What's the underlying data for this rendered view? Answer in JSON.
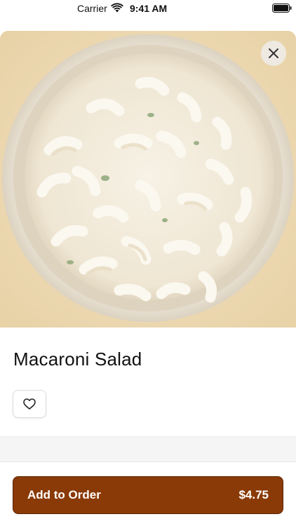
{
  "status_bar": {
    "carrier": "Carrier",
    "time": "9:41 AM",
    "wifi_icon": "wifi-icon",
    "battery_icon": "battery-icon"
  },
  "product": {
    "name": "Macaroni Salad",
    "image_description": "macaroni-salad-photo"
  },
  "actions": {
    "close_icon": "close-icon",
    "favorite_icon": "heart-icon",
    "add_to_order_label": "Add to Order",
    "price": "$4.75"
  },
  "colors": {
    "accent": "#8a3a06",
    "accent_border": "#5c2603",
    "background": "#ffffff"
  }
}
